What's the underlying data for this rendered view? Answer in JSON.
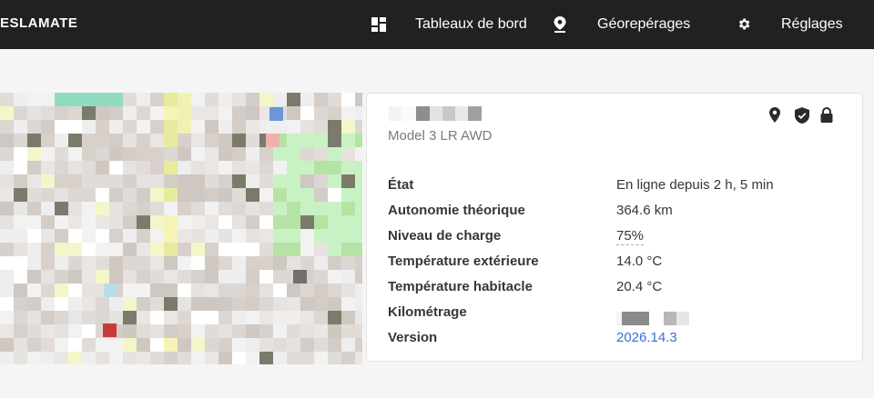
{
  "navbar": {
    "brand": "ESLAMATE",
    "items": [
      {
        "label": "Tableaux de bord",
        "icon": "dashboard-icon"
      },
      {
        "label": "Géorepérages",
        "icon": "map-marker-icon"
      },
      {
        "label": "Réglages",
        "icon": "gear-icon"
      }
    ]
  },
  "car": {
    "model": "Model 3 LR AWD",
    "status_icons": [
      "map-marker-icon",
      "shield-check-icon",
      "lock-icon"
    ],
    "rows": [
      {
        "label": "État",
        "value": "En ligne depuis 2 h, 5 min"
      },
      {
        "label": "Autonomie théorique",
        "value": "364.6 km"
      },
      {
        "label": "Niveau de charge",
        "value": "75%"
      },
      {
        "label": "Température extérieure",
        "value": "14.0 °C"
      },
      {
        "label": "Température habitacle",
        "value": "20.4 °C"
      },
      {
        "label": "Kilométrage",
        "value": ""
      },
      {
        "label": "Version",
        "value": "2026.14.3"
      }
    ]
  },
  "colors": {
    "navbar_bg": "#1f2123",
    "link": "#3273dc",
    "label_text": "#363636",
    "muted_text": "#7a7a7a"
  }
}
